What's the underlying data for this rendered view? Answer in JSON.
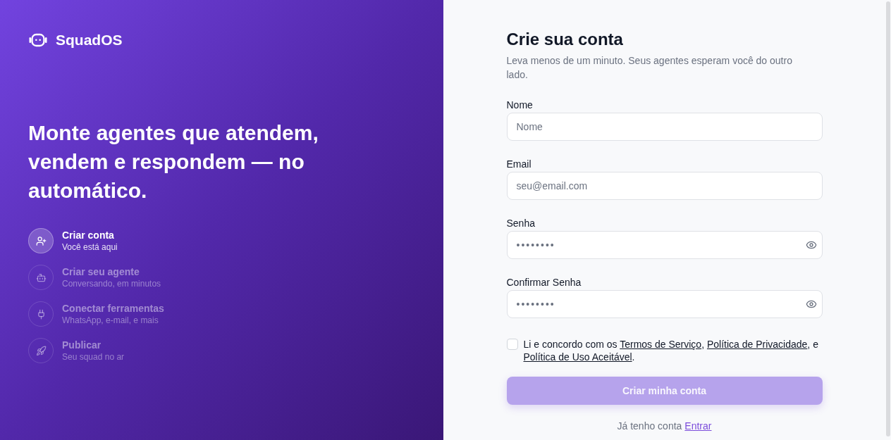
{
  "brand": {
    "name": "SquadOS"
  },
  "hero": {
    "headline": "Monte agentes que atendem, vendem e respondem — no automático."
  },
  "steps": [
    {
      "title": "Criar conta",
      "subtitle": "Você está aqui",
      "current": true
    },
    {
      "title": "Criar seu agente",
      "subtitle": "Conversando, em minutos",
      "current": false
    },
    {
      "title": "Conectar ferramentas",
      "subtitle": "WhatsApp, e-mail, e mais",
      "current": false
    },
    {
      "title": "Publicar",
      "subtitle": "Seu squad no ar",
      "current": false
    }
  ],
  "form": {
    "title": "Crie sua conta",
    "subtitle": "Leva menos de um minuto. Seus agentes esperam você do outro lado.",
    "fields": [
      {
        "label": "Nome",
        "kind": "text",
        "placeholder": "Nome"
      },
      {
        "label": "Email",
        "kind": "text",
        "placeholder": "seu@email.com"
      },
      {
        "label": "Senha",
        "kind": "password",
        "value": "••••••••"
      },
      {
        "label": "Confirmar Senha",
        "kind": "password",
        "value": "••••••••"
      }
    ],
    "agreement": {
      "checked": false,
      "parts": [
        {
          "kind": "text",
          "text": "Li e concordo com os "
        },
        {
          "kind": "link",
          "text": "Termos de Serviço"
        },
        {
          "kind": "text",
          "text": ", "
        },
        {
          "kind": "link",
          "text": "Política de Privacidade"
        },
        {
          "kind": "text",
          "text": ", e "
        },
        {
          "kind": "link",
          "text": "Política de Uso Aceitável"
        },
        {
          "kind": "text",
          "text": "."
        }
      ]
    },
    "submit_button": {
      "label": "Criar minha conta",
      "disabled": true
    },
    "login_prompt": {
      "text": "Já tenho conta",
      "link": "Entrar"
    }
  }
}
